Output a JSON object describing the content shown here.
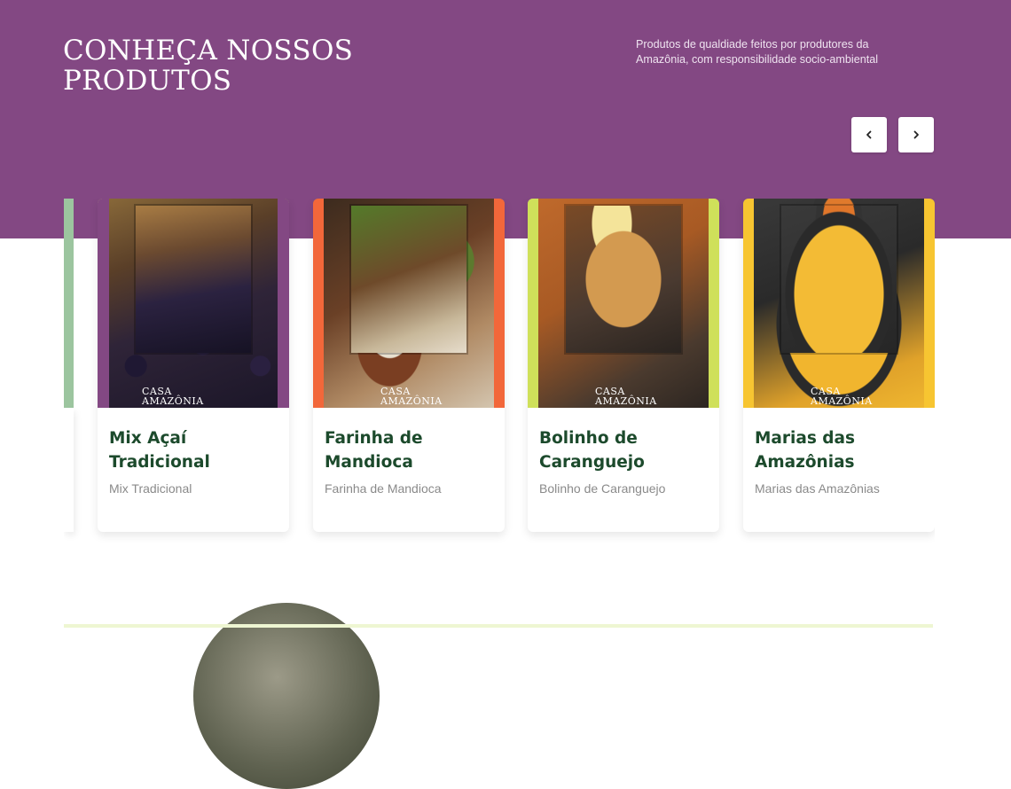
{
  "header": {
    "title_line1": "CONHEÇA NOSSOS",
    "title_line2": "PRODUTOS",
    "subtitle": "Produtos de qualdiade feitos por produtores da Amazônia, com responsibilidade socio-ambiental",
    "prev_icon": "chevron-left-icon",
    "next_icon": "chevron-right-icon"
  },
  "colors": {
    "hero_bg": "#834883",
    "heading_green": "#1c4a2c",
    "muted_text": "#8a8a8a",
    "card_border_orange": "#f2673a",
    "card_border_lime": "#cfe05a",
    "card_border_yellow": "#f7c531",
    "partial_card_green": "#9cc59f"
  },
  "products": [
    {
      "title": "Mix Açaí Tradicional",
      "subtitle": "Mix Tradicional",
      "image": "acai-berries-image",
      "brand_line1": "CASA",
      "brand_line2": "AMAZÔNIA",
      "frame_color": "#834883"
    },
    {
      "title": "Farinha de Mandioca",
      "subtitle": "Farinha de Mandioca",
      "image": "cassava-flour-image",
      "brand_line1": "CASA",
      "brand_line2": "AMAZÔNIA",
      "frame_color": "#f2673a"
    },
    {
      "title": "Bolinho de Caranguejo",
      "subtitle": "Bolinho de Caranguejo",
      "image": "crab-cake-image",
      "brand_line1": "CASA",
      "brand_line2": "AMAZÔNIA",
      "frame_color": "#cfe05a"
    },
    {
      "title": "Marias das Amazônias",
      "subtitle": "Marias das Amazônias",
      "image": "amazon-stew-image",
      "brand_line1": "CASA",
      "brand_line2": "AMAZÔNIA",
      "frame_color": "#f7c531"
    }
  ]
}
